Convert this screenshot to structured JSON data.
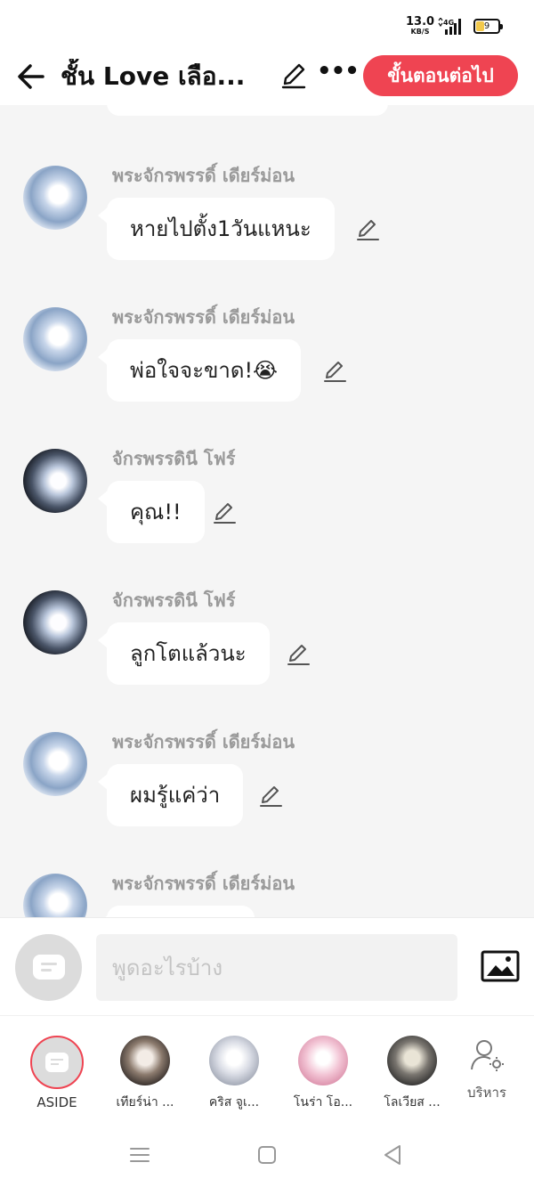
{
  "status_bar": {
    "net_speed": "13.0",
    "net_unit": "KB/S",
    "network": "4G",
    "battery": "9"
  },
  "header": {
    "title": "ชั้น Love เลือ...",
    "next_label": "ขั้นตอนต่อไป"
  },
  "messages": [
    {
      "sender": "พระจักรพรรดิ์ เดียร์ม่อน",
      "text": "หายไปตั้ง1วันแหนะ"
    },
    {
      "sender": "พระจักรพรรดิ์ เดียร์ม่อน",
      "text": "พ่อใจจะขาด!😭"
    },
    {
      "sender": "จักรพรรดินี โฟร์",
      "text": "คุณ!!"
    },
    {
      "sender": "จักรพรรดินี โฟร์",
      "text": "ลูกโตแล้วนะ"
    },
    {
      "sender": "พระจักรพรรดิ์ เดียร์ม่อน",
      "text": "ผมรู้แค่ว่า"
    },
    {
      "sender": "พระจักรพรรดิ์ เดียร์ม่อน",
      "text": ""
    }
  ],
  "composer": {
    "placeholder": "พูดอะไรบ้าง"
  },
  "characters": [
    {
      "label": "ASIDE"
    },
    {
      "label": "เทียร์น่า ..."
    },
    {
      "label": "คริส จูเ..."
    },
    {
      "label": "โนร่า โอ..."
    },
    {
      "label": "โลเวียส ..."
    }
  ],
  "manage_label": "บริหาร",
  "colors": {
    "accent": "#ef4452",
    "chat_bg": "#f5f5f5",
    "sender": "#9a9a9a"
  }
}
